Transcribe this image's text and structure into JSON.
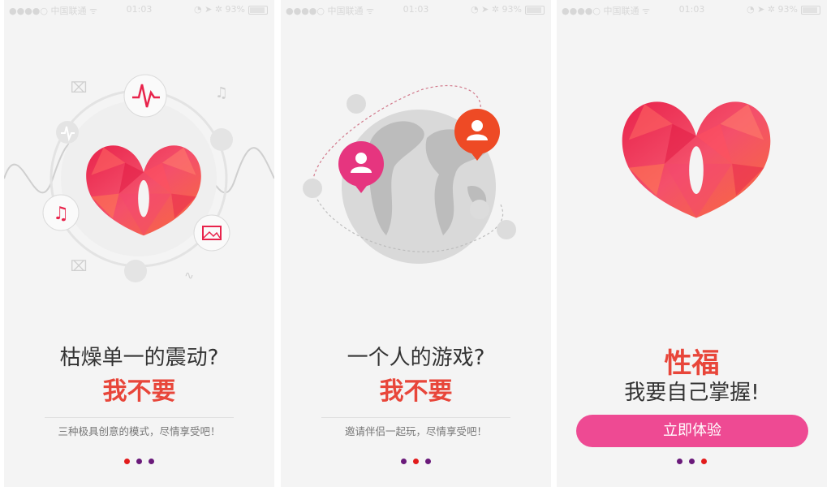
{
  "status_bar": {
    "carrier": "●●●●○ 中国联通 ᯤ",
    "time": "01:03",
    "battery": "◔ ➤ ✲ 93%"
  },
  "screens": [
    {
      "headline": "枯燥单一的震动?",
      "subline": "我不要",
      "description": "三种极具创意的模式，尽情享受吧！",
      "active_dot": 0,
      "icons": [
        "heartbeat-icon",
        "music-note-icon",
        "image-icon",
        "pulse-icon",
        "heart-logo-icon"
      ]
    },
    {
      "headline": "一个人的游戏?",
      "subline": "我不要",
      "description": "邀请伴侣一起玩，尽情享受吧！",
      "active_dot": 1,
      "icons": [
        "globe-icon",
        "user-pin-icon"
      ]
    },
    {
      "headline": "性福",
      "subline": "我要自己掌握!",
      "button_label": "立即体验",
      "active_dot": 2,
      "icons": [
        "heart-logo-icon"
      ]
    }
  ],
  "colors": {
    "accent_red": "#e8463a",
    "button_pink": "#ee4a93",
    "active_dot": "#e21b1b",
    "inactive_dot": "#6a1a7a",
    "background": "#f4f4f4"
  }
}
